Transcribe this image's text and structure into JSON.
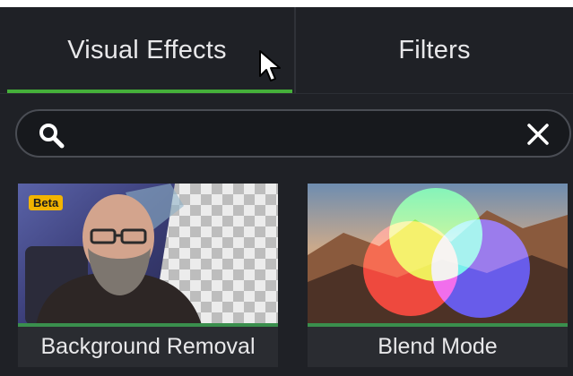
{
  "tabs": {
    "visual_effects": "Visual Effects",
    "filters": "Filters",
    "active": "Visual Effects"
  },
  "search": {
    "value": "",
    "placeholder": ""
  },
  "effects": [
    {
      "label": "Background Removal",
      "badge": "Beta"
    },
    {
      "label": "Blend Mode"
    }
  ],
  "colors": {
    "accent": "#45b03a",
    "panel": "#1f2126",
    "badge": "#f2b400"
  },
  "icons": [
    "search-icon",
    "close-icon",
    "mouse-cursor-icon"
  ]
}
